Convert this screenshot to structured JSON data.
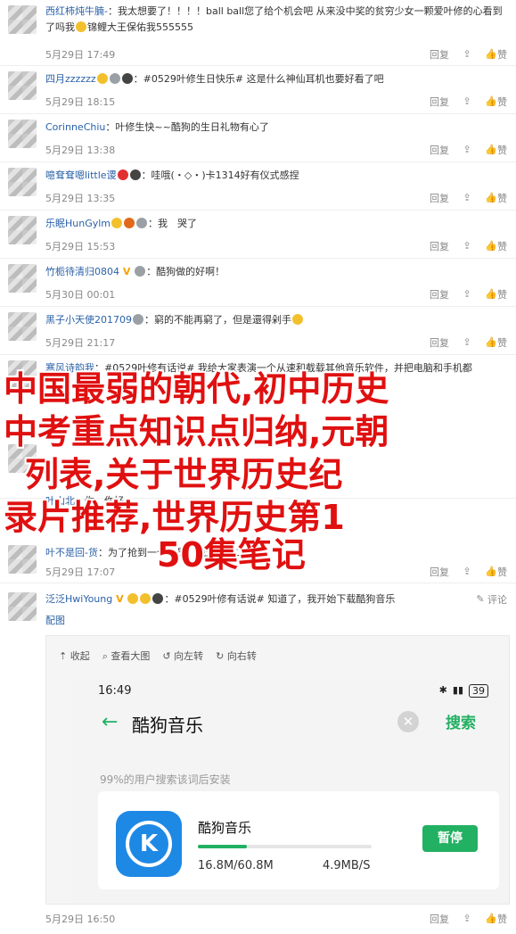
{
  "common": {
    "reply": "回复",
    "like": "赞",
    "comment": "评论",
    "image": "配图"
  },
  "comments": [
    {
      "user": "西红柿炖牛腩-",
      "text": "：我太想要了！！！！ball ball您了给个机会吧 从来没中奖的贫穷少女一颗爱叶修的心看到了吗我",
      "text2": "锦鲤大王保佑我555555",
      "time": "5月29日 17:49"
    },
    {
      "user": "四月zzzzzz",
      "text": "：#0529叶修生日快乐# 这是什么神仙耳机也要好看了吧",
      "time": "5月29日 18:15"
    },
    {
      "user": "CorinneChiu",
      "text": "：叶修生快~~酷狗的生日礼物有心了",
      "time": "5月29日 13:38"
    },
    {
      "user": "噫耷耷嗯little谡",
      "text": "：哇哦(・◇・)卡1314好有仪式感捏",
      "time": "5月29日 13:35"
    },
    {
      "user": "乐眠HunGylm",
      "text": "：我　哭了",
      "time": "5月29日 15:53"
    },
    {
      "user": "竹栀待清归0804",
      "text": "：酷狗做的好啊！",
      "time": "5月30日 00:01"
    },
    {
      "user": "黑子小天使201709",
      "text": "：窮的不能再窮了，但是還得剁手",
      "time": "5月29日 21:17"
    },
    {
      "user": "寒风诗韵我",
      "text": "：#0529叶修有话说# 我给大家表演一个从速和截载其他音乐软件，并把电脑和手机都",
      "time": ""
    },
    {
      "user": "叶山北",
      "text": "：你，你好",
      "time": ""
    },
    {
      "user": "叶不是回-货",
      "text": "：为了抢到一个会员，我还开我二三...",
      "time": "5月29日 17:07"
    }
  ],
  "last": {
    "user": "泛泛HwiYoung",
    "text": "：#0529叶修有话说# 知道了，我开始下载酷狗音乐",
    "time": "5月29日 16:50"
  },
  "overlay": {
    "l1": "中国最弱的朝代,初中历史",
    "l2": "中考重点知识点归纳,元朝",
    "l3": "列表,关于世界历史纪",
    "l4": "录片推荐,世界历史第1",
    "l5": "50集笔记"
  },
  "imgtools": {
    "collapse": "收起",
    "view": "查看大图",
    "rotate_left": "向左转",
    "rotate_right": "向右转"
  },
  "phone": {
    "time": "16:49",
    "battery": "39",
    "query": "酷狗音乐",
    "search": "搜索",
    "hint": "99%的用户搜索该词后安装",
    "app": "酷狗音乐",
    "icon_letter": "K",
    "size": "16.8M/60.8M",
    "speed": "4.9MB/S",
    "pause": "暂停",
    "progress": 0.28
  },
  "colors": {
    "link": "#2b62a8",
    "overlay": "#e01010",
    "accent": "#22b062"
  }
}
